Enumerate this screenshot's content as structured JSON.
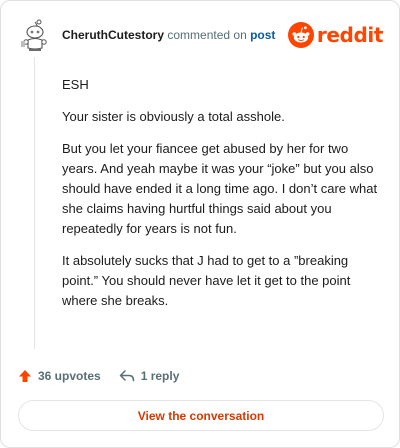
{
  "header": {
    "username": "CheruthCutestory",
    "action_text": "commented on",
    "post_label": "post",
    "brand": "reddit"
  },
  "comment": {
    "paragraphs": [
      "ESH",
      "Your sister is obviously a total asshole.",
      "But you let your fiancee get abused by her for two years. And yeah maybe it was your “joke” but you also should have ended it a long time ago. I don’t care what she claims having hurtful things said about you repeatedly for years is not fun.",
      "It absolutely sucks that J had to get to a ”breaking point.” You should never have let it get to the point where she breaks."
    ]
  },
  "footer": {
    "upvotes": "36 upvotes",
    "replies": "1 reply",
    "view_button": "View the conversation"
  },
  "colors": {
    "brand": "#ff4500",
    "link": "#0a5c9f",
    "button_text": "#d93900"
  }
}
